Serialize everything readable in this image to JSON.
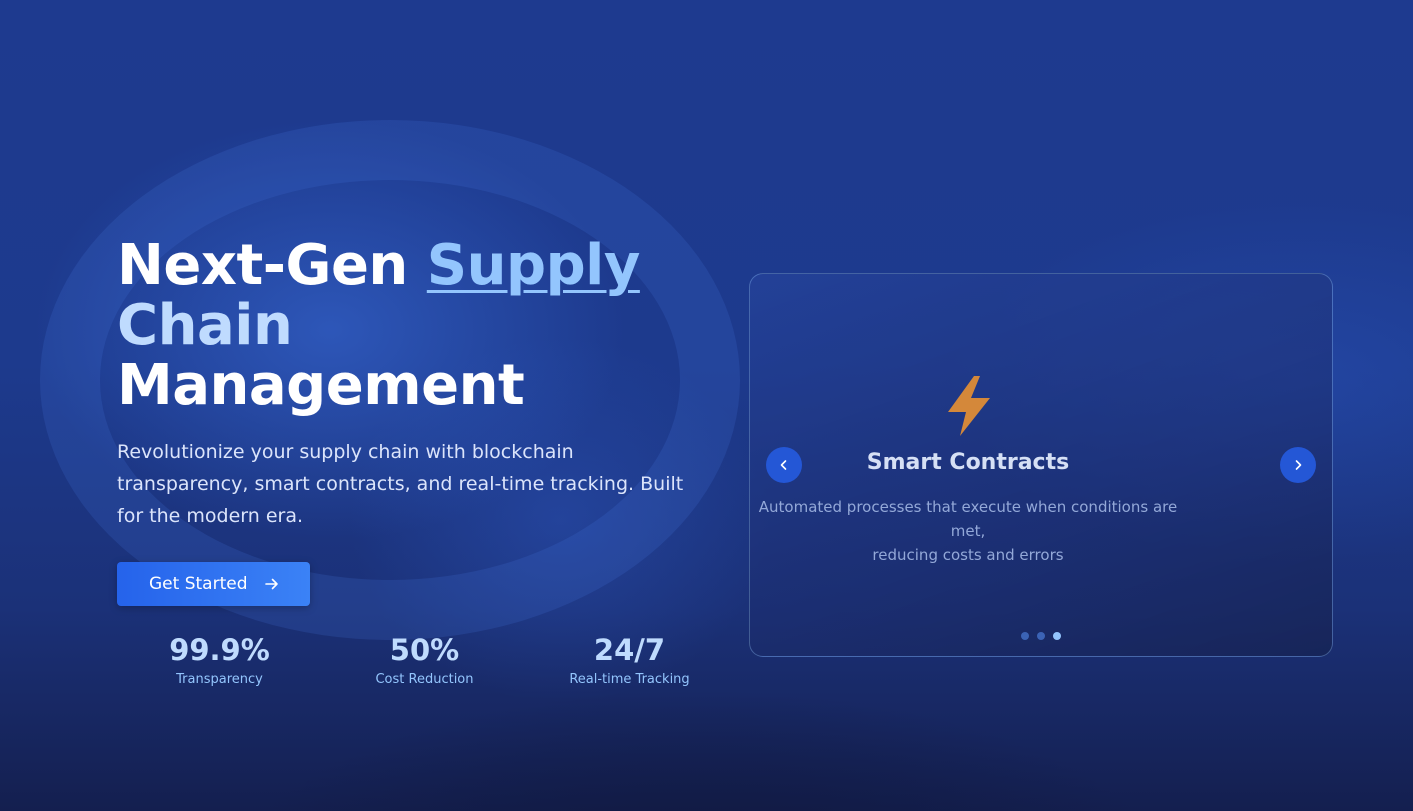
{
  "hero": {
    "title_part1": "Next-Gen ",
    "title_accent": "Supply",
    "title_part2": "Chain",
    "title_part3": "Management",
    "subtitle": "Revolutionize your supply chain with blockchain transparency, smart contracts, and real-time tracking. Built for the modern era.",
    "cta_label": "Get Started",
    "cta_icon": "arrow-right-icon"
  },
  "stats": [
    {
      "value": "99.9%",
      "label": "Transparency"
    },
    {
      "value": "50%",
      "label": "Cost Reduction"
    },
    {
      "value": "24/7",
      "label": "Real-time Tracking"
    }
  ],
  "carousel": {
    "slide": {
      "icon": "lightning-bolt-icon",
      "title": "Smart Contracts",
      "description_line1": "Automated processes that execute when conditions are met,",
      "description_line2": "reducing costs and errors"
    },
    "prev_icon": "chevron-left-icon",
    "next_icon": "chevron-right-icon",
    "dot_count": 3,
    "active_dot": 3
  },
  "colors": {
    "background": "#1e3a8a",
    "accent": "#93c5fd",
    "button": "#3b82f6",
    "icon_bolt": "#d4883a"
  }
}
